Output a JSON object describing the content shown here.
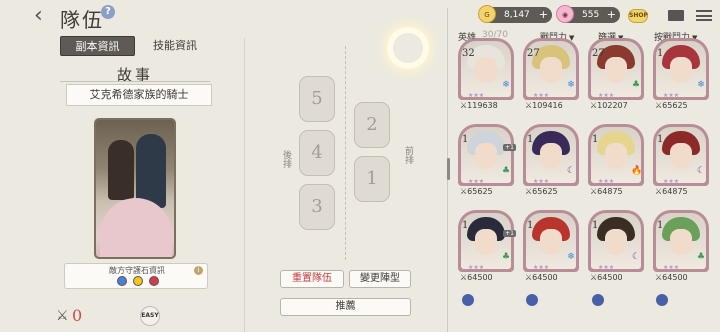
{
  "header": {
    "back_label": "‹",
    "title": "隊伍",
    "help_label": "?"
  },
  "left_panel": {
    "tabs": [
      {
        "label": "副本資訊",
        "active": true
      },
      {
        "label": "技能資訊",
        "active": false
      }
    ],
    "story_title": "故事",
    "stage_name": "艾克希德家族的騎士",
    "guardian_label": "敵方守護石資訊",
    "guardian_info_icon": "i",
    "guardian_gems": [
      "blue",
      "yellow",
      "red"
    ],
    "deaths_count": "0",
    "difficulty": "EASY"
  },
  "formation": {
    "back_row_label": "後排",
    "front_row_label": "前排",
    "slots": [
      "5",
      "4",
      "3",
      "2",
      "1"
    ],
    "reset_label": "重置隊伍",
    "change_label": "變更陣型",
    "recommend_label": "推薦"
  },
  "topbar": {
    "gold": "8,147",
    "gems": "555",
    "gold_icon": "G",
    "gem_icon": "◉",
    "shop_label": "SHOP"
  },
  "hero_list": {
    "heroes_label": "英雄",
    "count": "30/70",
    "filters": [
      "戰鬥力",
      "篩選",
      "按戰鬥力"
    ],
    "cards": [
      {
        "level": "32",
        "power": "119638",
        "hair": "#e8e4dc",
        "frame": "#b98d98",
        "elem": "❄",
        "elem_color": "#3d8ad8"
      },
      {
        "level": "27",
        "power": "109416",
        "hair": "#d9c37a",
        "frame": "#b98d98",
        "elem": "❄",
        "elem_color": "#3d8ad8"
      },
      {
        "level": "27",
        "power": "102207",
        "hair": "#8a3a2e",
        "frame": "#b98d98",
        "elem": "♣",
        "elem_color": "#3d9a56"
      },
      {
        "level": "1",
        "power": "65625",
        "hair": "#a8343c",
        "frame": "#b98d98",
        "elem": "❄",
        "elem_color": "#3d8ad8"
      },
      {
        "level": "1",
        "power": "65625",
        "hair": "#cfd3da",
        "frame": "#b98d98",
        "elem": "♣",
        "elem_color": "#3d9a56",
        "plus": "+1"
      },
      {
        "level": "1",
        "power": "65625",
        "hair": "#3a2a5a",
        "frame": "#b98d98",
        "elem": "☾",
        "elem_color": "#6a52a8"
      },
      {
        "level": "1",
        "power": "64875",
        "hair": "#e6d58e",
        "frame": "#b98d98",
        "elem": "🔥",
        "elem_color": "#d2503a"
      },
      {
        "level": "1",
        "power": "64875",
        "hair": "#8c2a2a",
        "frame": "#b98d98",
        "elem": "☾",
        "elem_color": "#6a52a8"
      },
      {
        "level": "1",
        "power": "64500",
        "hair": "#2a2a3a",
        "frame": "#b98d98",
        "elem": "♣",
        "elem_color": "#3d9a56",
        "plus": "+1"
      },
      {
        "level": "1",
        "power": "64500",
        "hair": "#b8342c",
        "frame": "#b98d98",
        "elem": "❄",
        "elem_color": "#3d8ad8"
      },
      {
        "level": "1",
        "power": "64500",
        "hair": "#3a2e24",
        "frame": "#b98d98",
        "elem": "☾",
        "elem_color": "#6a52a8"
      },
      {
        "level": "1",
        "power": "64500",
        "hair": "#6aa05a",
        "frame": "#b98d98",
        "elem": "♣",
        "elem_color": "#3d9a56"
      }
    ]
  }
}
